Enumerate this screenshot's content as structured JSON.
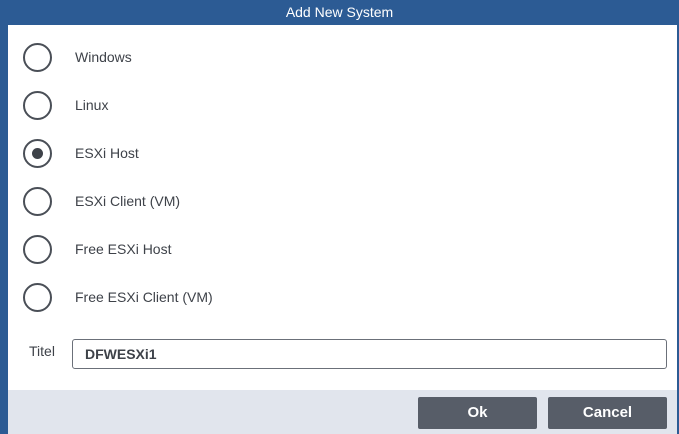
{
  "dialog": {
    "title": "Add New System"
  },
  "options": [
    {
      "label": "Windows",
      "checked": false
    },
    {
      "label": "Linux",
      "checked": false
    },
    {
      "label": "ESXi Host",
      "checked": true
    },
    {
      "label": "ESXi Client (VM)",
      "checked": false
    },
    {
      "label": "Free ESXi Host",
      "checked": false
    },
    {
      "label": "Free ESXi Client (VM)",
      "checked": false
    }
  ],
  "titel_field": {
    "label": "Titel",
    "value": "DFWESXi1"
  },
  "buttons": {
    "ok_label": "Ok",
    "cancel_label": "Cancel"
  },
  "colors": {
    "titlebar": "#2c5b94",
    "button": "#575d68",
    "footer": "#e1e5ed",
    "text": "#3e4249"
  }
}
